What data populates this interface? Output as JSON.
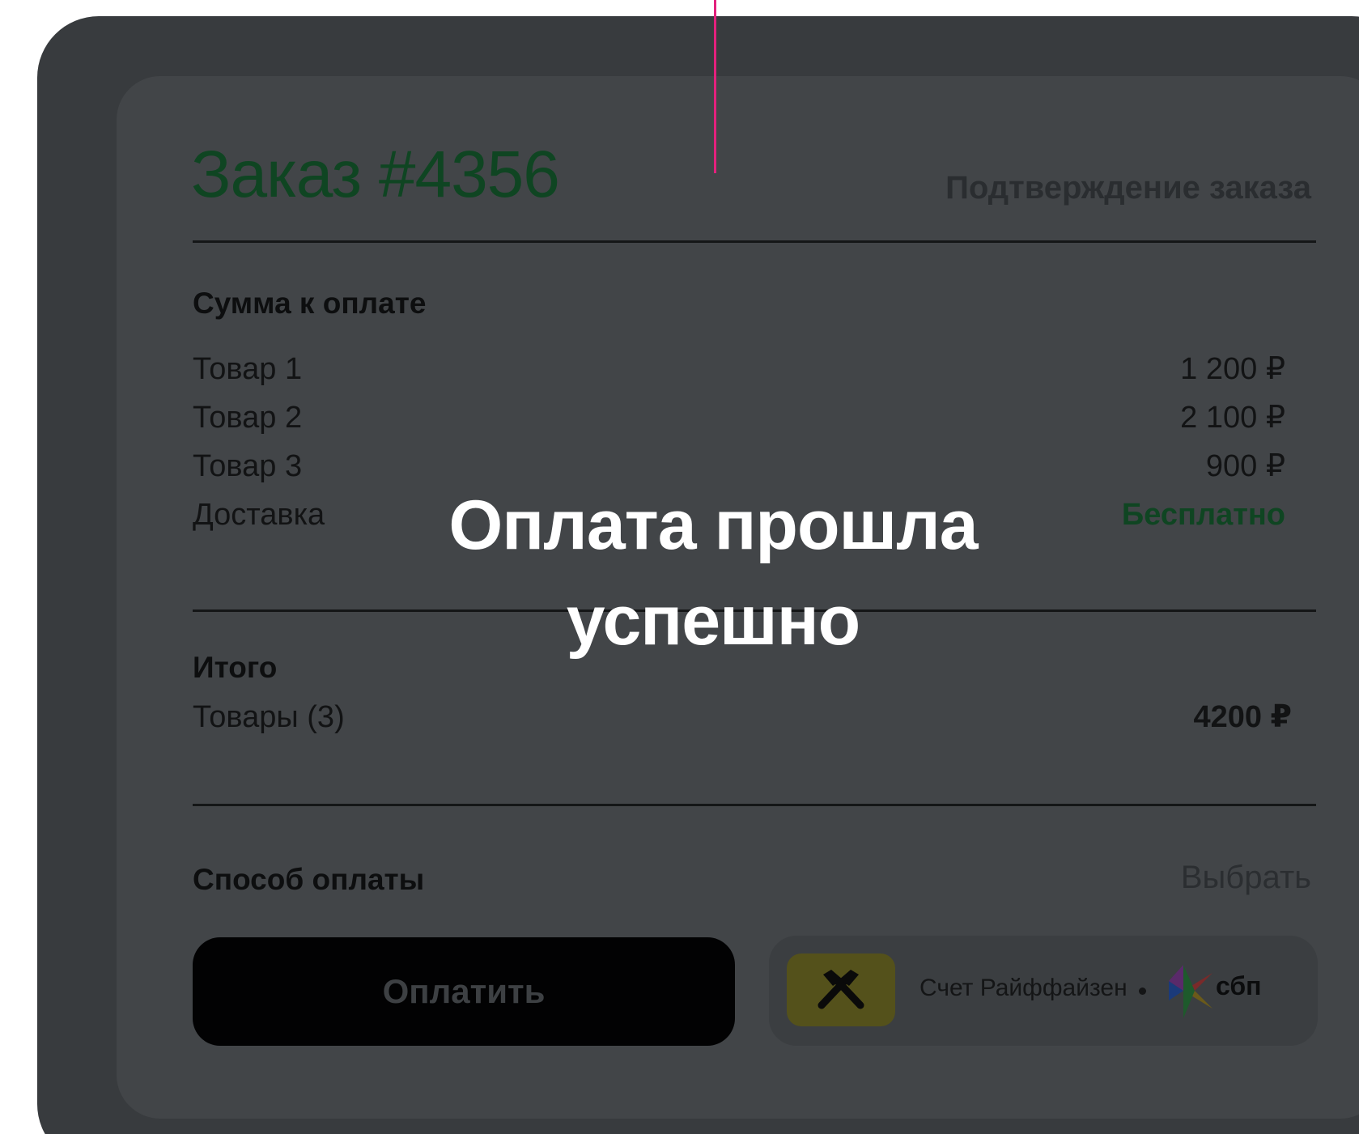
{
  "order": {
    "title": "Заказ #4356",
    "header_right": "Подтверждение заказа"
  },
  "payment_summary": {
    "title": "Сумма к оплате",
    "items": [
      {
        "label": "Товар 1",
        "value": "1 200 ₽"
      },
      {
        "label": "Товар 2",
        "value": "2 100 ₽"
      },
      {
        "label": "Товар 3",
        "value": "900 ₽"
      },
      {
        "label": "Доставка",
        "value": "Бесплатно"
      }
    ]
  },
  "total": {
    "title": "Итого",
    "label": "Товары (3)",
    "value": "4200 ₽"
  },
  "payment_method": {
    "title": "Способ оплаты",
    "choose_label": "Выбрать",
    "pay_button": "Оплатить",
    "method_label": "Счет Райффайзен",
    "sbp_label": "сбп"
  },
  "overlay": {
    "line1": "Оплата прошла",
    "line2": "успешно"
  },
  "colors": {
    "accent_green": "#0f4522",
    "marker_pink": "#e3217d",
    "raif_yellow": "#54511b"
  }
}
